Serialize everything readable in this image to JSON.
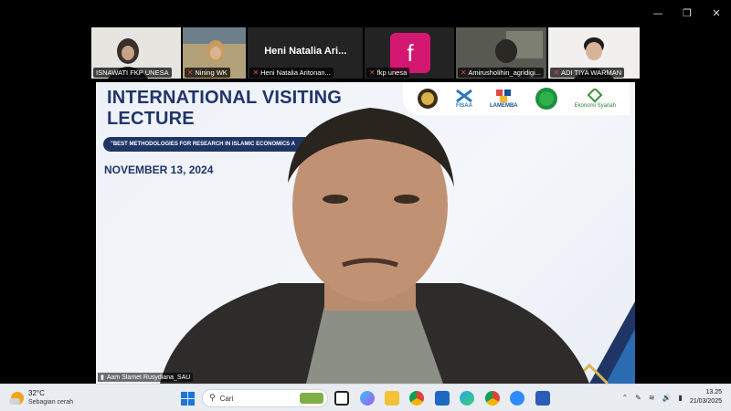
{
  "participants": [
    {
      "name": "ISNAWATI FKP UNESA",
      "muted": false
    },
    {
      "name": "Nining WK",
      "muted": true
    },
    {
      "name": "Heni Natalia Aritonan...",
      "muted": true,
      "display": "Heni Natalia Ari..."
    },
    {
      "name": "fkp unesa",
      "muted": true,
      "avatar_letter": "f"
    },
    {
      "name": "Amirusholihin_agridigi...",
      "muted": true
    },
    {
      "name": "ADI TIYA WARMAN",
      "muted": true
    }
  ],
  "slide": {
    "title": "INTERNATIONAL VISITING LECTURE",
    "subtitle": "\"BEST METHODOLOGIES FOR RESEARCH IN ISLAMIC ECONOMICS A",
    "date": "NOVEMBER 13, 2024",
    "logos": [
      "FISAA",
      "LAMEMBA",
      "Ekonomi Syariah"
    ],
    "accent": "#1f3566"
  },
  "speaker": {
    "name": "Aam Slamet Rusydiana_SAU"
  },
  "taskbar": {
    "temperature": "32°C",
    "weather_text": "Sebagian cerah",
    "search_label": "Cari",
    "time": "13.25",
    "date": "21/03/2025"
  }
}
